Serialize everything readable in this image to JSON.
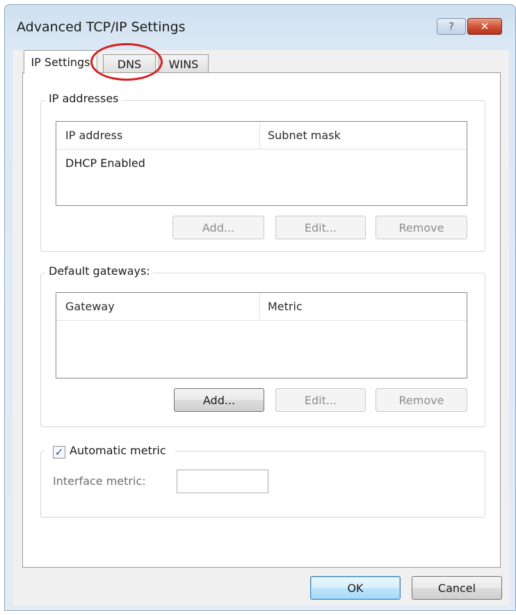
{
  "window": {
    "title": "Advanced TCP/IP Settings",
    "help_label": "?",
    "close_label": "✕"
  },
  "tabs": [
    {
      "label": "IP Settings",
      "active": true
    },
    {
      "label": "DNS",
      "active": false,
      "highlighted": true
    },
    {
      "label": "WINS",
      "active": false
    }
  ],
  "ip_addresses": {
    "group_label": "IP addresses",
    "columns": [
      "IP address",
      "Subnet mask"
    ],
    "rows": [
      [
        "DHCP Enabled",
        ""
      ]
    ],
    "buttons": {
      "add": "Add...",
      "edit": "Edit...",
      "remove": "Remove"
    },
    "buttons_enabled": {
      "add": false,
      "edit": false,
      "remove": false
    }
  },
  "default_gateways": {
    "group_label": "Default gateways:",
    "columns": [
      "Gateway",
      "Metric"
    ],
    "rows": [],
    "buttons": {
      "add": "Add...",
      "edit": "Edit...",
      "remove": "Remove"
    },
    "buttons_enabled": {
      "add": true,
      "edit": false,
      "remove": false
    }
  },
  "metric": {
    "automatic_label": "Automatic metric",
    "automatic_checked": true,
    "interface_label": "Interface metric:",
    "interface_value": ""
  },
  "footer": {
    "ok": "OK",
    "cancel": "Cancel"
  },
  "colors": {
    "highlight_ring": "#d42020",
    "default_button": "#3c7fb1"
  }
}
